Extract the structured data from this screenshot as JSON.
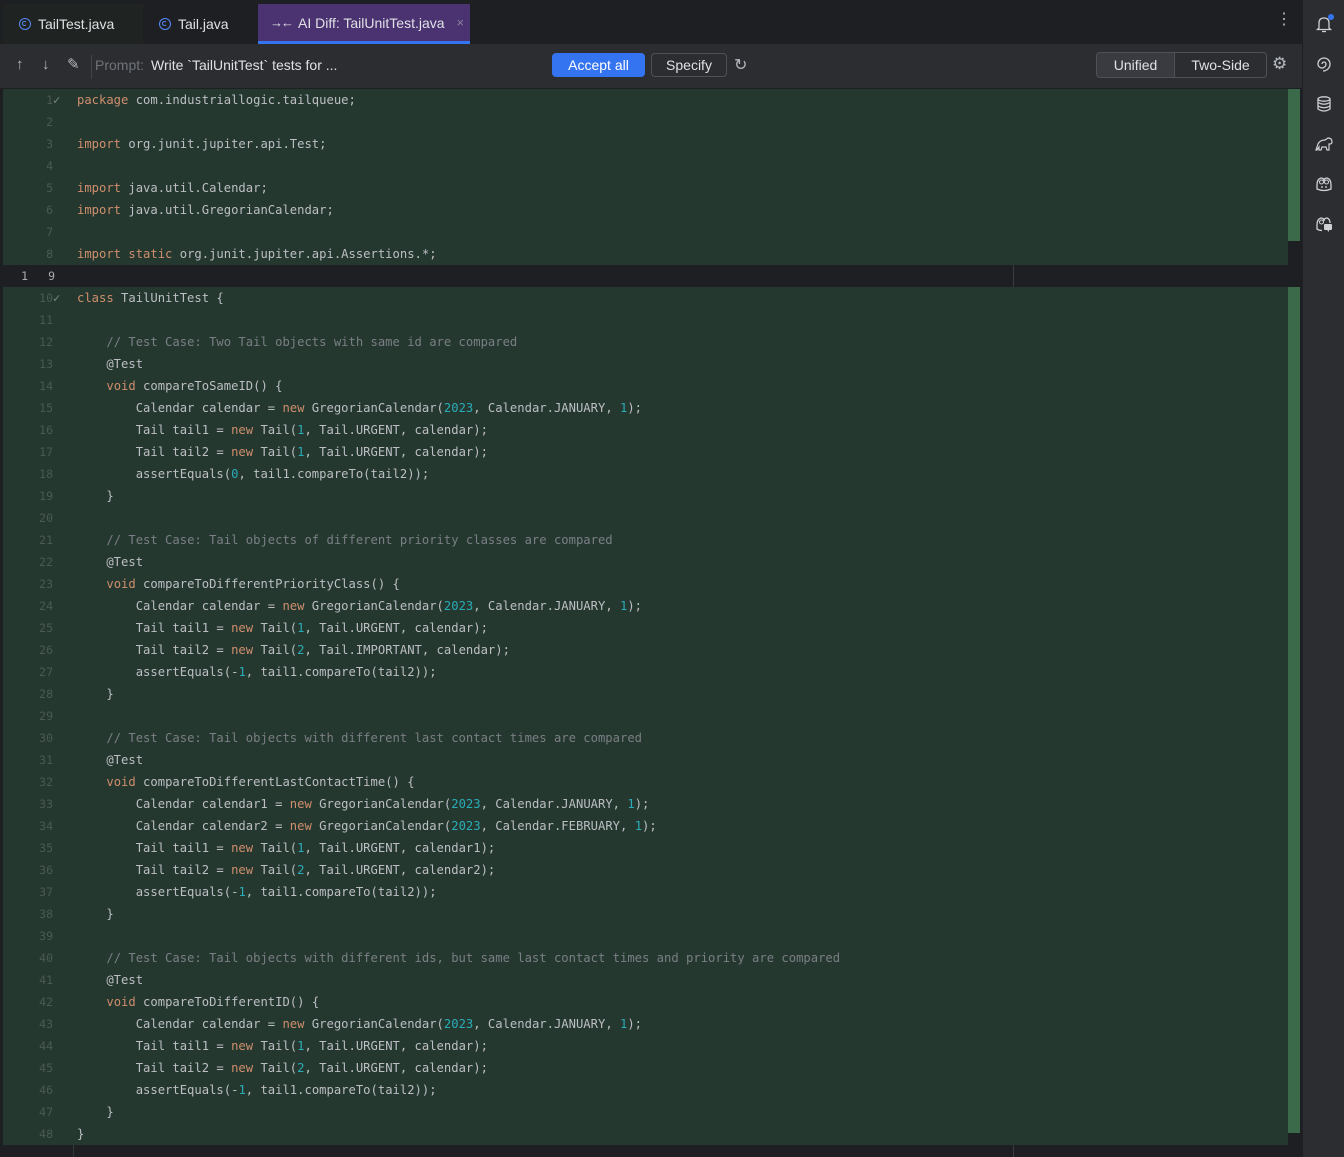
{
  "tabs": [
    {
      "label": "TailTest.java",
      "icon": "java-class-icon"
    },
    {
      "label": "Tail.java",
      "icon": "java-class-icon"
    },
    {
      "label": "AI Diff: TailUnitTest.java",
      "icon": "ai-diff-icon",
      "active": true,
      "close": "×"
    }
  ],
  "tab_menu": "⋮",
  "toolbar": {
    "prev_diff": "↑",
    "next_diff": "↓",
    "edit": "✎",
    "prompt_label": "Prompt:",
    "prompt_text": "Write `TailUnitTest` tests for ...",
    "accept_all": "Accept all",
    "specify": "Specify",
    "regenerate": "↻",
    "view_unified": "Unified",
    "view_two_side": "Two-Side",
    "settings": "⚙",
    "accent_color": "#3574f0"
  },
  "editor": {
    "unchanged_line": {
      "left_number": "1",
      "right_number": "9"
    },
    "lines": [
      {
        "n": "1",
        "mark": "✓",
        "html": "<span class=\"kw\">package</span> com.industriallogic.tailqueue;"
      },
      {
        "n": "2",
        "html": ""
      },
      {
        "n": "3",
        "html": "<span class=\"kw\">import</span> org.junit.jupiter.api.Test;"
      },
      {
        "n": "4",
        "html": ""
      },
      {
        "n": "5",
        "html": "<span class=\"kw\">import</span> java.util.Calendar;"
      },
      {
        "n": "6",
        "html": "<span class=\"kw\">import</span> java.util.GregorianCalendar;"
      },
      {
        "n": "7",
        "html": ""
      },
      {
        "n": "8",
        "html": "<span class=\"kw\">import static</span> org.junit.jupiter.api.Assertions.*;"
      },
      {
        "n": "9",
        "unchanged": true,
        "html": ""
      },
      {
        "n": "10",
        "mark": "✓",
        "html": "<span class=\"kw\">class</span> TailUnitTest {"
      },
      {
        "n": "11",
        "html": ""
      },
      {
        "n": "12",
        "html": "    <span class=\"cm\">// Test Case: Two Tail objects with same id are compared</span>"
      },
      {
        "n": "13",
        "html": "    @Test"
      },
      {
        "n": "14",
        "html": "    <span class=\"kw\">void</span> compareToSameID() {"
      },
      {
        "n": "15",
        "html": "        Calendar calendar = <span class=\"kw\">new</span> GregorianCalendar(<span class=\"num\">2023</span>, Calendar.JANUARY, <span class=\"num\">1</span>);"
      },
      {
        "n": "16",
        "html": "        Tail tail1 = <span class=\"kw\">new</span> Tail(<span class=\"num\">1</span>, Tail.URGENT, calendar);"
      },
      {
        "n": "17",
        "html": "        Tail tail2 = <span class=\"kw\">new</span> Tail(<span class=\"num\">1</span>, Tail.URGENT, calendar);"
      },
      {
        "n": "18",
        "html": "        assertEquals(<span class=\"num\">0</span>, tail1.compareTo(tail2));"
      },
      {
        "n": "19",
        "html": "    }"
      },
      {
        "n": "20",
        "html": ""
      },
      {
        "n": "21",
        "html": "    <span class=\"cm\">// Test Case: Tail objects of different priority classes are compared</span>"
      },
      {
        "n": "22",
        "html": "    @Test"
      },
      {
        "n": "23",
        "html": "    <span class=\"kw\">void</span> compareToDifferentPriorityClass() {"
      },
      {
        "n": "24",
        "html": "        Calendar calendar = <span class=\"kw\">new</span> GregorianCalendar(<span class=\"num\">2023</span>, Calendar.JANUARY, <span class=\"num\">1</span>);"
      },
      {
        "n": "25",
        "html": "        Tail tail1 = <span class=\"kw\">new</span> Tail(<span class=\"num\">1</span>, Tail.URGENT, calendar);"
      },
      {
        "n": "26",
        "html": "        Tail tail2 = <span class=\"kw\">new</span> Tail(<span class=\"num\">2</span>, Tail.IMPORTANT, calendar);"
      },
      {
        "n": "27",
        "html": "        assertEquals(-<span class=\"num\">1</span>, tail1.compareTo(tail2));"
      },
      {
        "n": "28",
        "html": "    }"
      },
      {
        "n": "29",
        "html": ""
      },
      {
        "n": "30",
        "html": "    <span class=\"cm\">// Test Case: Tail objects with different last contact times are compared</span>"
      },
      {
        "n": "31",
        "html": "    @Test"
      },
      {
        "n": "32",
        "html": "    <span class=\"kw\">void</span> compareToDifferentLastContactTime() {"
      },
      {
        "n": "33",
        "html": "        Calendar calendar1 = <span class=\"kw\">new</span> GregorianCalendar(<span class=\"num\">2023</span>, Calendar.JANUARY, <span class=\"num\">1</span>);"
      },
      {
        "n": "34",
        "html": "        Calendar calendar2 = <span class=\"kw\">new</span> GregorianCalendar(<span class=\"num\">2023</span>, Calendar.FEBRUARY, <span class=\"num\">1</span>);"
      },
      {
        "n": "35",
        "html": "        Tail tail1 = <span class=\"kw\">new</span> Tail(<span class=\"num\">1</span>, Tail.URGENT, calendar1);"
      },
      {
        "n": "36",
        "html": "        Tail tail2 = <span class=\"kw\">new</span> Tail(<span class=\"num\">2</span>, Tail.URGENT, calendar2);"
      },
      {
        "n": "37",
        "html": "        assertEquals(-<span class=\"num\">1</span>, tail1.compareTo(tail2));"
      },
      {
        "n": "38",
        "html": "    }"
      },
      {
        "n": "39",
        "html": ""
      },
      {
        "n": "40",
        "html": "    <span class=\"cm\">// Test Case: Tail objects with different ids, but same last contact times and priority are compared</span>"
      },
      {
        "n": "41",
        "html": "    @Test"
      },
      {
        "n": "42",
        "html": "    <span class=\"kw\">void</span> compareToDifferentID() {"
      },
      {
        "n": "43",
        "html": "        Calendar calendar = <span class=\"kw\">new</span> GregorianCalendar(<span class=\"num\">2023</span>, Calendar.JANUARY, <span class=\"num\">1</span>);"
      },
      {
        "n": "44",
        "html": "        Tail tail1 = <span class=\"kw\">new</span> Tail(<span class=\"num\">1</span>, Tail.URGENT, calendar);"
      },
      {
        "n": "45",
        "html": "        Tail tail2 = <span class=\"kw\">new</span> Tail(<span class=\"num\">2</span>, Tail.URGENT, calendar);"
      },
      {
        "n": "46",
        "html": "        assertEquals(-<span class=\"num\">1</span>, tail1.compareTo(tail2));"
      },
      {
        "n": "47",
        "html": "    }"
      },
      {
        "n": "48",
        "html": "}"
      }
    ]
  },
  "right_toolbar": [
    {
      "name": "notifications-icon",
      "glyph": "🔔",
      "badge": true
    },
    {
      "name": "ai-assistant-icon",
      "glyph": "◎"
    },
    {
      "name": "database-icon",
      "glyph": "⛁"
    },
    {
      "name": "gradle-icon",
      "glyph": "🐘"
    },
    {
      "name": "copilot-icon",
      "glyph": "☻"
    },
    {
      "name": "copilot-chat-icon",
      "glyph": "☻"
    }
  ]
}
